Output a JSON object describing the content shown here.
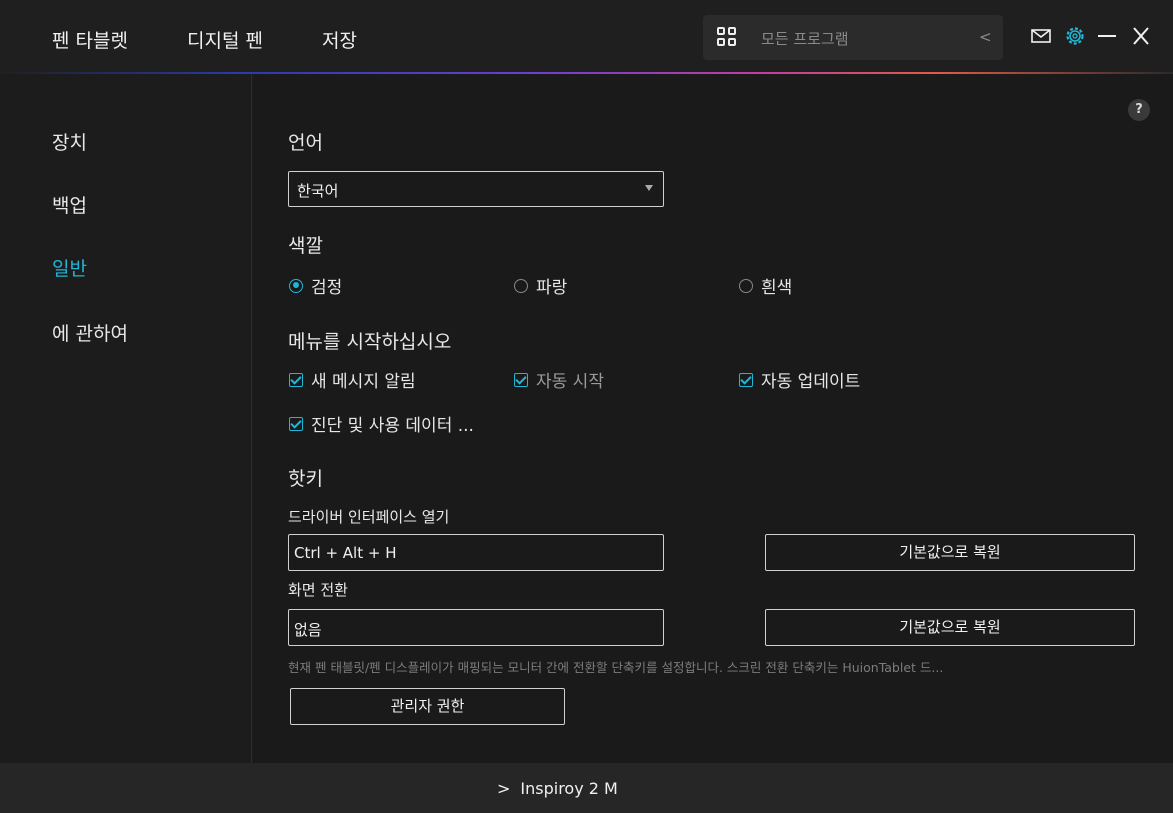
{
  "header": {
    "tabs": [
      {
        "label": "펜 타블렛"
      },
      {
        "label": "디지털 펜"
      },
      {
        "label": "저장"
      }
    ],
    "program_selector": {
      "label": "모든 프로그램",
      "chevron": "<"
    },
    "icons": [
      "mail-icon",
      "gear-icon",
      "minimize-icon",
      "close-icon"
    ],
    "accent_color": "#21b6d6"
  },
  "sidebar": {
    "items": [
      {
        "label": "장치"
      },
      {
        "label": "백업"
      },
      {
        "label": "일반",
        "active": true
      },
      {
        "label": "에 관하여"
      }
    ]
  },
  "main": {
    "help": "?",
    "language": {
      "title": "언어",
      "value": "한국어"
    },
    "color": {
      "title": "색깔",
      "options": [
        {
          "label": "검정",
          "selected": true
        },
        {
          "label": "파랑",
          "selected": false
        },
        {
          "label": "흰색",
          "selected": false
        }
      ]
    },
    "startup": {
      "title": "메뉴를 시작하십시오",
      "options": [
        {
          "label": "새 메시지 알림",
          "checked": true
        },
        {
          "label": "자동 시작",
          "checked": true
        },
        {
          "label": "자동 업데이트",
          "checked": true
        },
        {
          "label": "진단 및 사용 데이터 ...",
          "checked": true
        }
      ]
    },
    "hotkeys": {
      "title": "핫키",
      "open_driver_label": "드라이버 인터페이스  열기",
      "open_driver_value": "Ctrl + Alt + H",
      "restore_default_1": "기본값으로 복원",
      "switch_screen_label": "화면 전환",
      "switch_screen_value": "없음",
      "restore_default_2": "기본값으로 복원",
      "hint": "현재 펜 태블릿/펜 디스플레이가 매핑되는 모니터 간에 전환할 단축키를 설정합니다. 스크린 전환 단축키는 HuionTablet 드...",
      "admin_button": "관리자 권한"
    }
  },
  "footer": {
    "chevron": ">",
    "device": "Inspiroy 2 M"
  }
}
